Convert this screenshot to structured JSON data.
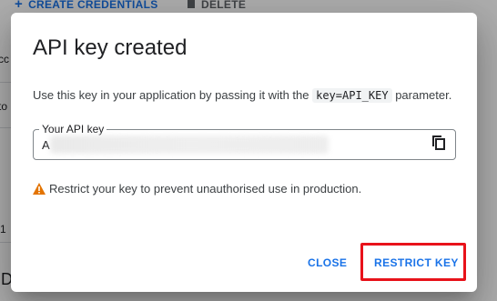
{
  "background": {
    "create_label": "CREATE CREDENTIALS",
    "delete_label": "DELETE",
    "left_fragments": [
      "cc",
      "to",
      "1",
      "ID"
    ]
  },
  "dialog": {
    "title": "API key created",
    "description_before": "Use this key in your application by passing it with the ",
    "description_code": "key=API_KEY",
    "description_after": " parameter.",
    "key_field": {
      "label": "Your API key",
      "value_visible_prefix": "A"
    },
    "warning_text": "Restrict your key to prevent unauthorised use in production.",
    "close_label": "CLOSE",
    "restrict_label": "RESTRICT KEY"
  },
  "colors": {
    "accent": "#1a73e8",
    "highlight_outline": "#e8121a",
    "warning": "#e37400"
  }
}
